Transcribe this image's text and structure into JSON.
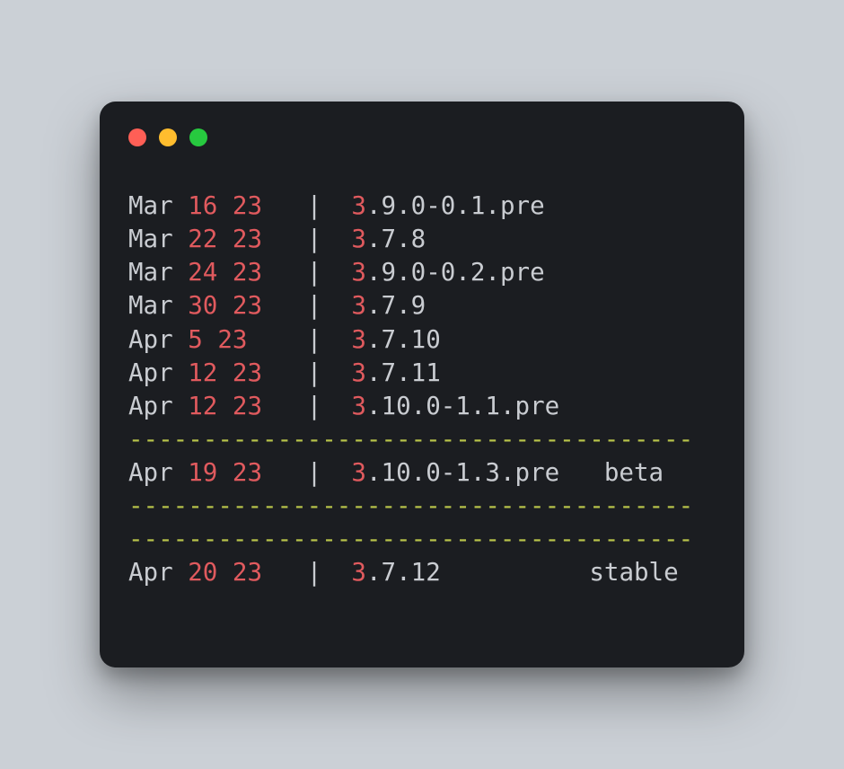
{
  "colors": {
    "bg_page": "#cbd0d6",
    "bg_window": "#1b1d21",
    "text": "#c9ccd1",
    "number": "#e05a5e",
    "separator": "#b7c24a",
    "traffic_red": "#ff5f56",
    "traffic_yellow": "#ffbd2e",
    "traffic_green": "#27c93f"
  },
  "lines": [
    {
      "type": "entry",
      "month": "Mar",
      "day": "16",
      "year": "23",
      "version_major": "3",
      "version_rest": ".9.0-0.1.pre",
      "channel": ""
    },
    {
      "type": "entry",
      "month": "Mar",
      "day": "22",
      "year": "23",
      "version_major": "3",
      "version_rest": ".7.8",
      "channel": ""
    },
    {
      "type": "entry",
      "month": "Mar",
      "day": "24",
      "year": "23",
      "version_major": "3",
      "version_rest": ".9.0-0.2.pre",
      "channel": ""
    },
    {
      "type": "entry",
      "month": "Mar",
      "day": "30",
      "year": "23",
      "version_major": "3",
      "version_rest": ".7.9",
      "channel": ""
    },
    {
      "type": "entry",
      "month": "Apr",
      "day": "5",
      "year": "23",
      "version_major": "3",
      "version_rest": ".7.10",
      "channel": ""
    },
    {
      "type": "entry",
      "month": "Apr",
      "day": "12",
      "year": "23",
      "version_major": "3",
      "version_rest": ".7.11",
      "channel": ""
    },
    {
      "type": "entry",
      "month": "Apr",
      "day": "12",
      "year": "23",
      "version_major": "3",
      "version_rest": ".10.0-1.1.pre",
      "channel": ""
    },
    {
      "type": "sep"
    },
    {
      "type": "entry",
      "month": "Apr",
      "day": "19",
      "year": "23",
      "version_major": "3",
      "version_rest": ".10.0-1.3.pre",
      "channel": "beta"
    },
    {
      "type": "sep"
    },
    {
      "type": "sep"
    },
    {
      "type": "entry",
      "month": "Apr",
      "day": "20",
      "year": "23",
      "version_major": "3",
      "version_rest": ".7.12",
      "channel": "stable"
    }
  ],
  "layout": {
    "date_col_width": 10,
    "pipe": "  |  ",
    "version_col_width": 13,
    "sep_char": "-",
    "sep_len": 38
  }
}
